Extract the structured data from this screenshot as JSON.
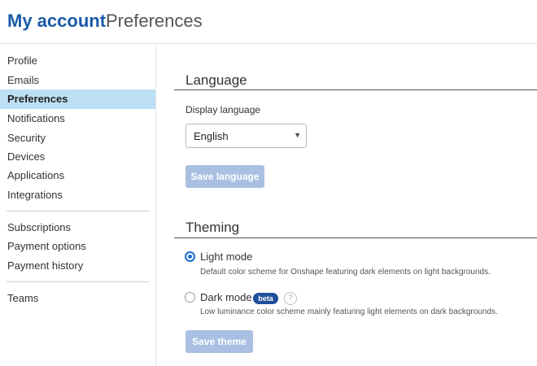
{
  "header": {
    "title": "My account",
    "subtitle": "Preferences"
  },
  "sidebar": {
    "items": [
      {
        "label": "Profile"
      },
      {
        "label": "Emails"
      },
      {
        "label": "Preferences",
        "active": true
      },
      {
        "label": "Notifications"
      },
      {
        "label": "Security"
      },
      {
        "label": "Devices"
      },
      {
        "label": "Applications"
      },
      {
        "label": "Integrations"
      },
      {
        "label": "Subscriptions"
      },
      {
        "label": "Payment options"
      },
      {
        "label": "Payment history"
      },
      {
        "label": "Teams"
      }
    ]
  },
  "language": {
    "section_title": "Language",
    "field_label": "Display language",
    "selected": "English",
    "save_label": "Save language"
  },
  "theming": {
    "section_title": "Theming",
    "options": [
      {
        "label": "Light mode",
        "description": "Default color scheme for Onshape featuring dark elements on light backgrounds.",
        "selected": true
      },
      {
        "label": "Dark mode",
        "description": "Low luminance color scheme mainly featuring light elements on dark backgrounds.",
        "selected": false,
        "badge": "beta"
      }
    ],
    "help_glyph": "?",
    "save_label": "Save theme"
  },
  "icons": {
    "help": "help-icon",
    "dropdown": "chevron-down-icon"
  },
  "colors": {
    "accent": "#1a5aa8",
    "active_bg": "#bde0f6",
    "button_disabled": "#a9c0e2",
    "badge": "#1f4f9a",
    "radio": "#1e6fd0"
  }
}
